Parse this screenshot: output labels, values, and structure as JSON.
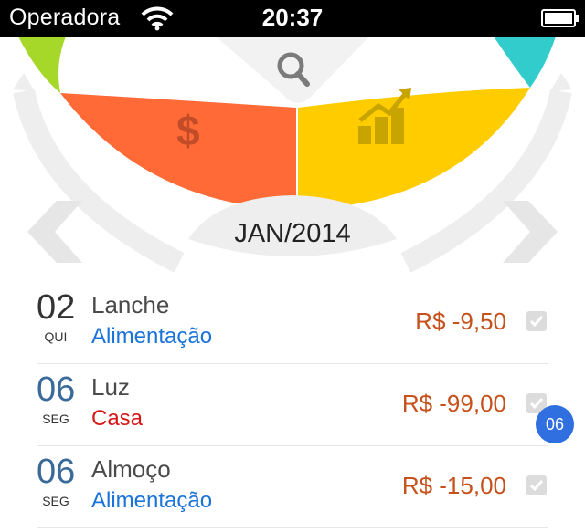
{
  "status_bar": {
    "carrier": "Operadora",
    "time": "20:37",
    "icons": [
      "wifi-icon",
      "battery-icon"
    ]
  },
  "header": {
    "month": "JAN/2014",
    "wheel_icons": [
      "search-icon",
      "dollar-icon",
      "chart-icon"
    ],
    "navigation": [
      "chevron-left-icon",
      "chevron-right-icon"
    ],
    "colors": {
      "green": "#a6d82a",
      "orange": "#ff6a37",
      "yellow": "#ffcc00",
      "teal": "#33cccc"
    }
  },
  "transactions": [
    {
      "day": "02",
      "weekday": "QUI",
      "description": "Lanche",
      "category": "Alimentação",
      "amount": "R$ -9,50",
      "checked": true
    },
    {
      "day": "06",
      "weekday": "SEG",
      "description": "Luz",
      "category": "Casa",
      "amount": "R$ -99,00",
      "checked": true
    },
    {
      "day": "06",
      "weekday": "SEG",
      "description": "Almoço",
      "category": "Alimentação",
      "amount": "R$ -15,00",
      "checked": true
    }
  ],
  "badge": {
    "day": "06"
  }
}
